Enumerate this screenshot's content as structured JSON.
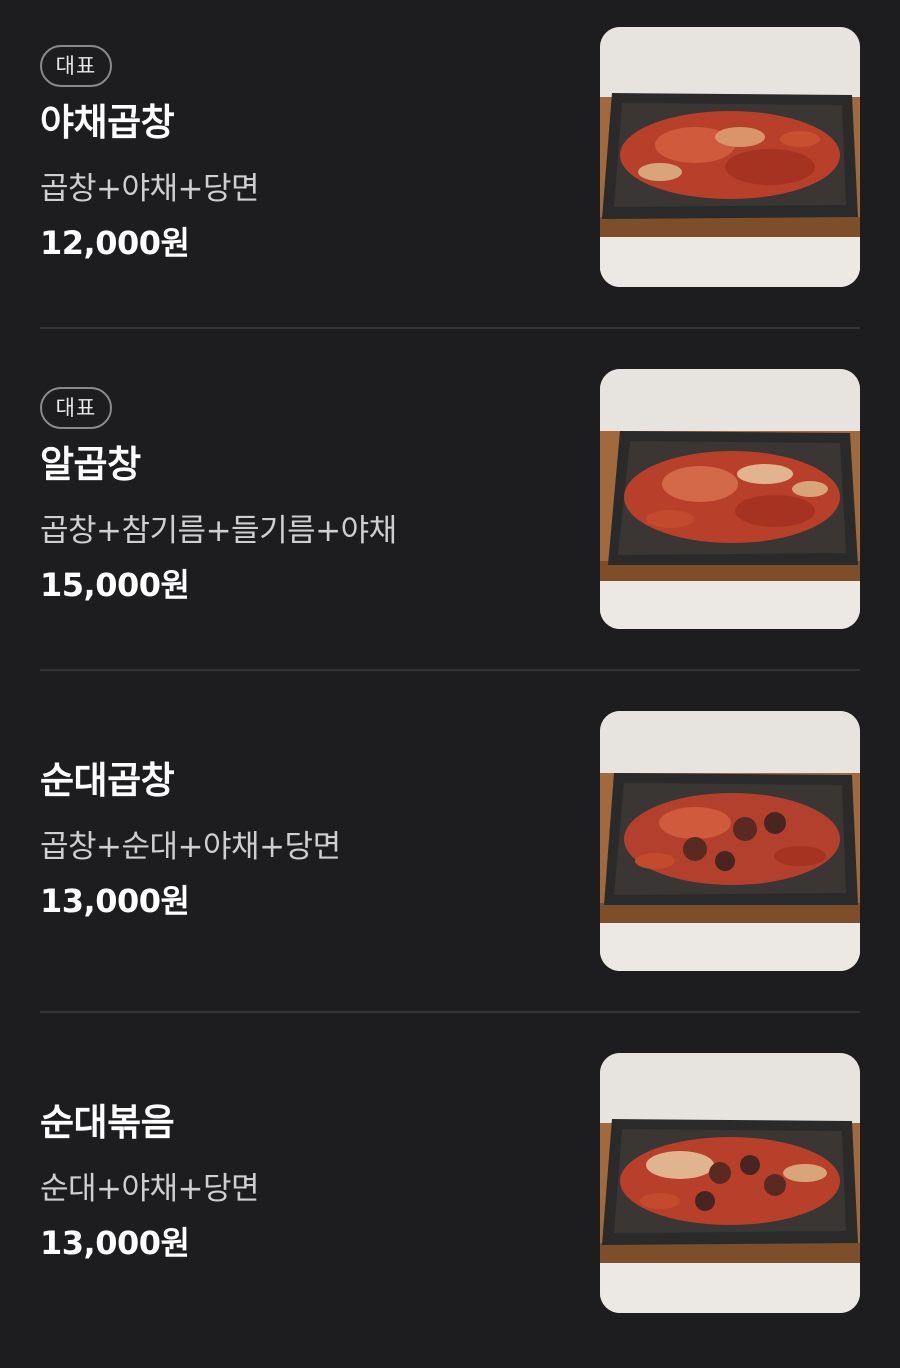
{
  "menu": {
    "items": [
      {
        "badge": "대표",
        "name": "야채곱창",
        "description": "곱창+야채+당면",
        "price": "12,000원",
        "image_alt": "야채곱창"
      },
      {
        "badge": "대표",
        "name": "알곱창",
        "description": "곱창+참기름+들기름+야채",
        "price": "15,000원",
        "image_alt": "알곱창"
      },
      {
        "badge": "",
        "name": "순대곱창",
        "description": "곱창+순대+야채+당면",
        "price": "13,000원",
        "image_alt": "순대곱창"
      },
      {
        "badge": "",
        "name": "순대볶음",
        "description": "순대+야채+당면",
        "price": "13,000원",
        "image_alt": "순대볶음"
      }
    ]
  },
  "colors": {
    "background": "#1d1d1f",
    "text": "#ffffff",
    "subtext": "#cfcfcf",
    "badge_border": "#8a8a8a",
    "divider": "#333336"
  }
}
